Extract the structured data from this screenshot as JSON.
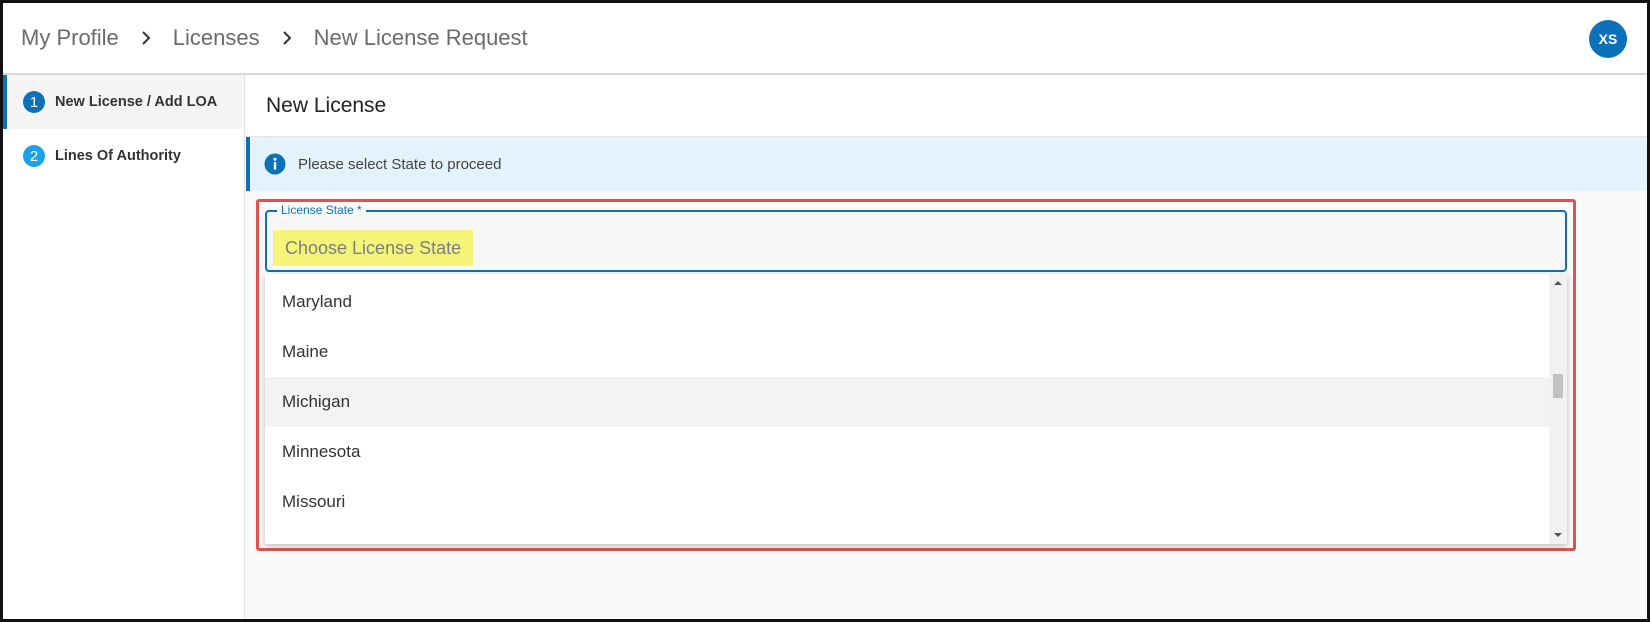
{
  "breadcrumb": {
    "items": [
      "My Profile",
      "Licenses",
      "New License Request"
    ]
  },
  "user": {
    "initials": "XS"
  },
  "sidebar": {
    "steps": [
      {
        "number": "1",
        "label": "New License / Add LOA"
      },
      {
        "number": "2",
        "label": "Lines Of Authority"
      }
    ]
  },
  "main": {
    "title": "New License",
    "info": "Please select State to proceed",
    "field": {
      "label": "License State *",
      "placeholder": "Choose License State"
    },
    "options": [
      "Maryland",
      "Maine",
      "Michigan",
      "Minnesota",
      "Missouri"
    ],
    "hovered_option": "Michigan"
  },
  "colors": {
    "primary": "#0b72b9",
    "info_bg": "#e3f2fb",
    "highlight_border": "#e05252",
    "placeholder_highlight": "#f5f57a"
  }
}
